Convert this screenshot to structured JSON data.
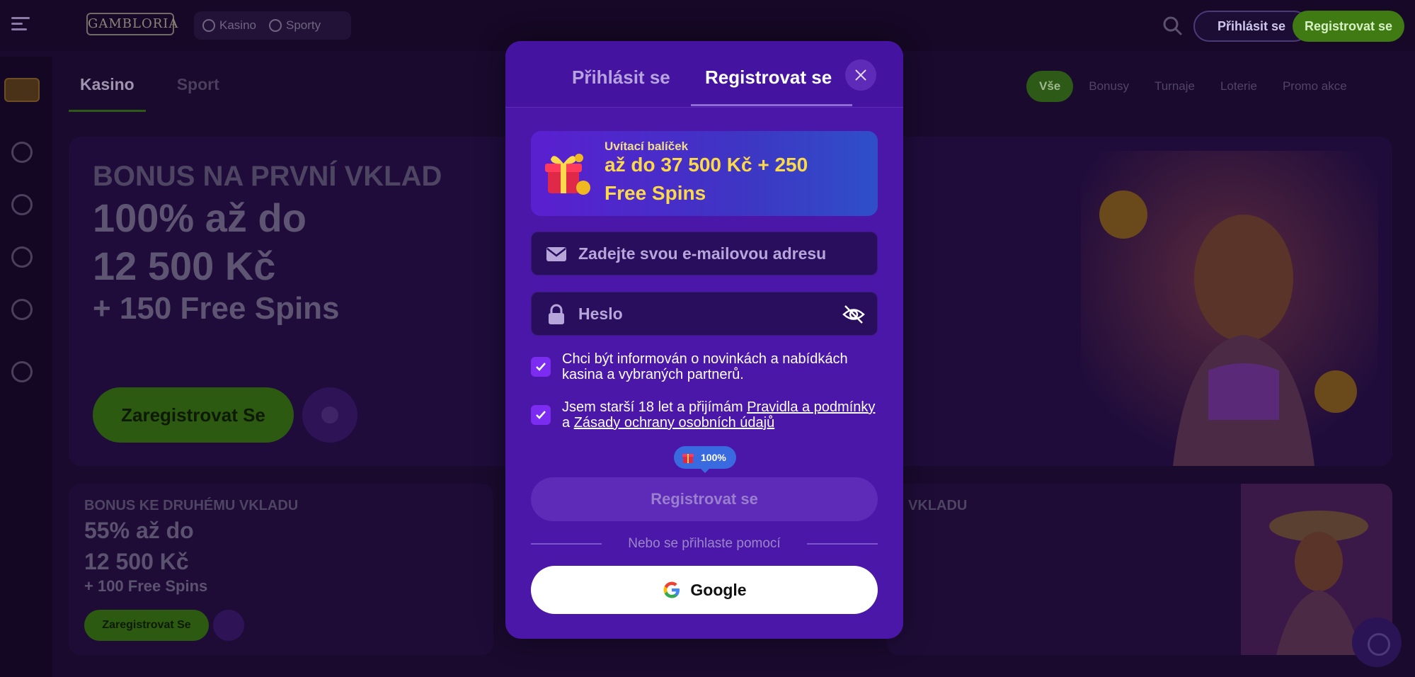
{
  "header": {
    "logo_text": "GAMBLORIA",
    "nav": [
      {
        "label": "Kasino",
        "icon": "casino-icon"
      },
      {
        "label": "Sporty",
        "icon": "sport-icon"
      }
    ],
    "login_label": "Přihlásit se",
    "register_label": "Registrovat se"
  },
  "main": {
    "tabs": [
      {
        "label": "Kasino",
        "active": true
      },
      {
        "label": "Sport",
        "active": false
      }
    ],
    "filters": [
      {
        "label": "Vše",
        "active": true
      },
      {
        "label": "Bonusy",
        "active": false
      },
      {
        "label": "Turnaje",
        "active": false
      },
      {
        "label": "Loterie",
        "active": false
      },
      {
        "label": "Promo akce",
        "active": false
      }
    ],
    "hero": {
      "subtitle": "BONUS NA PRVNÍ VKLAD",
      "line1": "100% až do",
      "line2": "12 500 Kč",
      "line3": "+ 150 Free Spins",
      "cta": "Zaregistrovat Se"
    },
    "card1": {
      "subtitle": "BONUS KE DRUHÉMU VKLADU",
      "line1": "55% až do",
      "line2": "12 500 Kč",
      "line3": "+ 100 Free Spins",
      "cta": "Zaregistrovat Se"
    },
    "card2": {
      "subtitle": "VKLADU"
    }
  },
  "modal": {
    "tab_login": "Přihlásit se",
    "tab_register": "Registrovat se",
    "promo": {
      "label": "Uvítací balíček",
      "line1": "až do 37 500 Kč + 250",
      "line2": "Free Spins"
    },
    "email_placeholder": "Zadejte svou e-mailovou adresu",
    "password_placeholder": "Heslo",
    "consent_news": "Chci být informován o novinkách a nabídkách kasina a vybraných partnerů.",
    "consent_age_prefix": "Jsem starší 18 let a přijímám ",
    "consent_age_link1": "Pravidla a podmínky",
    "consent_age_mid": " a ",
    "consent_age_link2": "Zásady ochrany osobních údajů",
    "bonus_progress": "100%",
    "submit_label": "Registrovat se",
    "divider_text": "Nebo se přihlaste pomocí",
    "google_label": "Google"
  },
  "colors": {
    "modal_bg": "#4a17a8",
    "promo_text": "#fbd94a",
    "checkbox": "#7b2cf0",
    "green_button": "#3f7a13"
  }
}
